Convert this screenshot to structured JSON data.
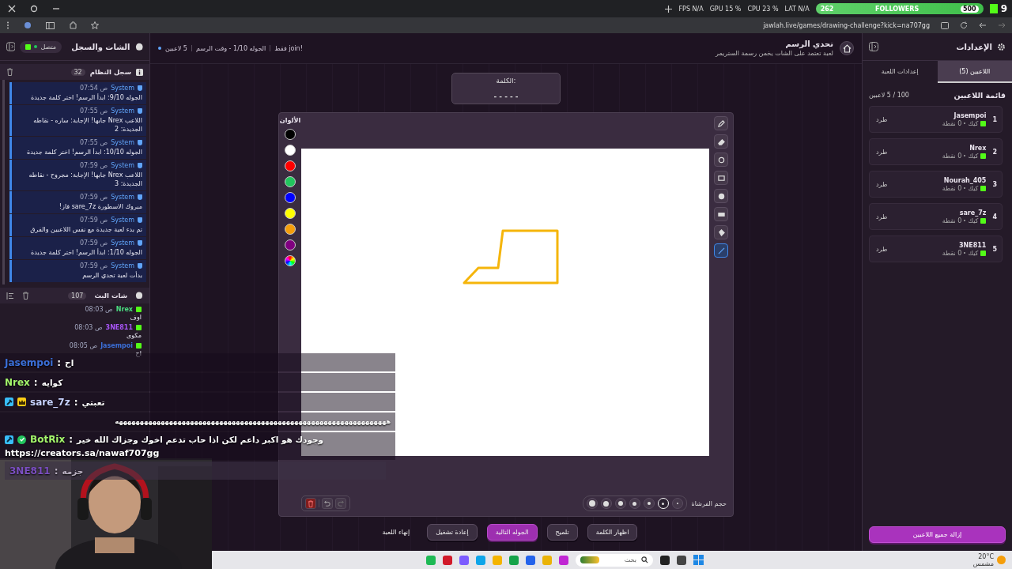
{
  "browser": {
    "stats": [
      {
        "text": "LAT N/A"
      },
      {
        "text": "CPU 23 %"
      },
      {
        "text": "GPU 15 %"
      },
      {
        "text": "FPS N/A"
      }
    ],
    "followers": {
      "current": "262",
      "label": "FOLLOWERS",
      "goal": "500"
    },
    "corner_count": "9",
    "url": "jawlah.live/games/drawing-challenge?kick=na707gg"
  },
  "left_panel": {
    "title": "الشات والسجل",
    "status": "متصل",
    "system_log": {
      "title": "سجل النظام",
      "count": "32",
      "messages": [
        {
          "author": "System",
          "time": "07:54 ص",
          "text": "الجوله 9/10: ابدأ الرسم! اختر كلمة جديدة"
        },
        {
          "author": "System",
          "time": "07:55 ص",
          "text": "اللاعب Nrex جابها! الإجابة: ساره - نقاطه الجديدة: 2"
        },
        {
          "author": "System",
          "time": "07:55 ص",
          "text": "الجوله 10/10: ابدأ الرسم! اختر كلمة جديدة"
        },
        {
          "author": "System",
          "time": "07:59 ص",
          "text": "اللاعب Nrex جابها! الإجابة: مجروح - نقاطه الجديدة: 3"
        },
        {
          "author": "System",
          "time": "07:59 ص",
          "text": "مبروك الاسطورة sare_7z فاز!"
        },
        {
          "author": "System",
          "time": "07:59 ص",
          "text": "تم بدء لعبة جديدة مع نفس اللاعبين والفرق"
        },
        {
          "author": "System",
          "time": "07:59 ص",
          "text": "الجوله 1/10: ابدأ الرسم! اختر كلمة جديدة"
        },
        {
          "author": "System",
          "time": "07:59 ص",
          "text": "بدأت لعبة تحدي الرسم"
        }
      ]
    },
    "stream_chat": {
      "title": "شات البث",
      "count": "107",
      "messages": [
        {
          "user": "Nrex",
          "color": "#4ade80",
          "time": "08:03 ص",
          "text": "اوف"
        },
        {
          "user": "3NE811",
          "color": "#a855f7",
          "time": "08:03 ص",
          "text": "مكوى"
        },
        {
          "user": "Jasempoi",
          "color": "#3b6fd8",
          "time": "08:05 ص",
          "text": "اح"
        }
      ]
    }
  },
  "game": {
    "title": "تحدي الرسم",
    "subtitle": "لعبة تعتمد على الشات يخمن رسمة الستريمر",
    "players_info": "5 لاعبين",
    "round_info": "الجوله 1/10 - وقت الرسم",
    "join_info": "!join فقط",
    "word": {
      "label": "الكلمة:",
      "hint": "- - - - -"
    },
    "colors_title": "الألوان",
    "colors": [
      {
        "kind": "solid",
        "color": "#000000"
      },
      {
        "kind": "solid",
        "color": "#ffffff"
      },
      {
        "kind": "solid",
        "color": "#ff0000"
      },
      {
        "kind": "solid",
        "color": "#22c55e"
      },
      {
        "kind": "solid",
        "color": "#0000ff"
      },
      {
        "kind": "solid",
        "color": "#ffff00"
      },
      {
        "kind": "solid",
        "color": "#f59e0b"
      },
      {
        "kind": "solid",
        "color": "#800080"
      },
      {
        "kind": "gradient"
      }
    ],
    "tools": [
      {
        "kind": "pencil",
        "selected": false
      },
      {
        "kind": "eraser",
        "selected": false
      },
      {
        "kind": "circle",
        "selected": false
      },
      {
        "kind": "rectangle",
        "selected": false
      },
      {
        "kind": "filled-circle",
        "selected": false
      },
      {
        "kind": "filled-rectangle",
        "selected": false
      },
      {
        "kind": "bucket",
        "selected": false
      },
      {
        "kind": "line",
        "selected": true
      }
    ],
    "brush_label": "حجم الفرشاة",
    "brush_sizes": [
      {
        "selected": false
      },
      {
        "selected": true
      },
      {
        "selected": false
      },
      {
        "selected": false
      },
      {
        "selected": false
      },
      {
        "selected": false
      },
      {
        "selected": false
      }
    ],
    "actions": [
      {
        "label": "اظهار الكلمة",
        "kind": "secondary"
      },
      {
        "label": "تلميح",
        "kind": "secondary"
      },
      {
        "label": "الجوله التالية",
        "kind": "primary"
      },
      {
        "label": "إعادة تشغيل",
        "kind": "secondary"
      },
      {
        "label": "إنهاء اللعبة",
        "kind": "plain"
      }
    ]
  },
  "right_panel": {
    "title": "الإعدادات",
    "tabs": [
      {
        "label": "اللاعبين (5)",
        "selected": true
      },
      {
        "label": "إعدادات اللعبة",
        "selected": false
      }
    ],
    "list_title": "قائمة اللاعبين",
    "list_count": "100 / 5 لاعبين",
    "players": [
      {
        "rank": "1",
        "name": "Jasempoi",
        "platform": "كيك",
        "points": "0 نقطة",
        "action": "طرد"
      },
      {
        "rank": "2",
        "name": "Nrex",
        "platform": "كيك",
        "points": "0 نقطة",
        "action": "طرد"
      },
      {
        "rank": "3",
        "name": "Nourah_405",
        "platform": "كيك",
        "points": "0 نقطة",
        "action": "طرد"
      },
      {
        "rank": "4",
        "name": "sare_7z",
        "platform": "كيك",
        "points": "0 نقطة",
        "action": "طرد"
      },
      {
        "rank": "5",
        "name": "3NE811",
        "platform": "كيك",
        "points": "0 نقطة",
        "action": "طرد"
      }
    ],
    "remove_all": "إزالة جميع اللاعبين"
  },
  "overlay_chat": [
    {
      "kind": "chat",
      "moderator": false,
      "vip": false,
      "verified": false,
      "user": "Jasempoi",
      "color": "#3b6fd8",
      "separator": ":",
      "text": "اح",
      "faded": false
    },
    {
      "kind": "chat",
      "moderator": false,
      "vip": false,
      "verified": false,
      "user": "Nrex",
      "color": "#a3f56b",
      "separator": ":",
      "text": "كوايه",
      "faded": false
    },
    {
      "kind": "chat",
      "moderator": true,
      "vip": true,
      "verified": false,
      "user": "sare_7z",
      "color": "#c7d2fe",
      "separator": ":",
      "text": "تعبتي",
      "faded": false
    },
    {
      "kind": "text",
      "text": "هههههههههههههههههههههههههههههههههههههههههههههههههههههههههههههههههه"
    },
    {
      "kind": "chat",
      "moderator": true,
      "vip": false,
      "verified": true,
      "user": "BotRix",
      "color": "#a3f56b",
      "separator": ":",
      "text": "وجودك هو اكبر داعم لكن اذا حاب تدعم اخوك وجزاك الله خير",
      "link": "https://creators.sa/nawaf707gg",
      "faded": false
    },
    {
      "kind": "chat",
      "moderator": false,
      "vip": false,
      "verified": false,
      "user": "3NE811",
      "color": "#7c4fc4",
      "separator": ":",
      "text": "جزمه",
      "faded": true
    }
  ],
  "taskbar": {
    "apps": [
      {
        "color": "#1db954"
      },
      {
        "color": "#d11a2a"
      },
      {
        "color": "#7c5cff"
      },
      {
        "color": "#0ea5e9"
      },
      {
        "color": "#f4b400"
      },
      {
        "color": "#16a34a"
      },
      {
        "color": "#2563eb"
      },
      {
        "color": "#eab308"
      },
      {
        "color": "#c026d3"
      },
      {
        "color": "#222222"
      },
      {
        "color": "#444444"
      }
    ],
    "search_placeholder": "بحث",
    "temperature": "20°C",
    "weather": "مشمس"
  }
}
